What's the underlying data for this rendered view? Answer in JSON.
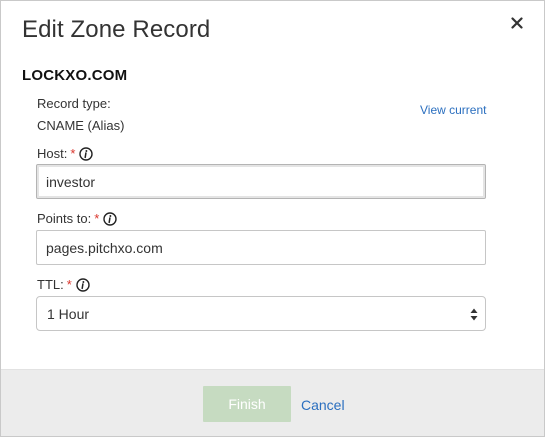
{
  "dialog": {
    "title": "Edit Zone Record",
    "domain": "LOCKXO.COM"
  },
  "record_type": {
    "label": "Record type:",
    "value": "CNAME (Alias)",
    "view_current_link": "View current"
  },
  "fields": {
    "host": {
      "label": "Host:",
      "required_mark": "*",
      "value": "investor"
    },
    "points_to": {
      "label": "Points to:",
      "required_mark": "*",
      "value": "pages.pitchxo.com"
    },
    "ttl": {
      "label": "TTL:",
      "required_mark": "*",
      "selected": "1 Hour"
    }
  },
  "footer": {
    "finish_label": "Finish",
    "cancel_label": "Cancel"
  },
  "colors": {
    "link": "#2b6fbf",
    "required": "#d9342b",
    "finish_disabled_bg": "#c6dbc1",
    "footer_bg": "#ececec"
  },
  "icons": {
    "close": "close-icon",
    "info": "info-icon",
    "select_arrows": "updown-arrows-icon"
  }
}
